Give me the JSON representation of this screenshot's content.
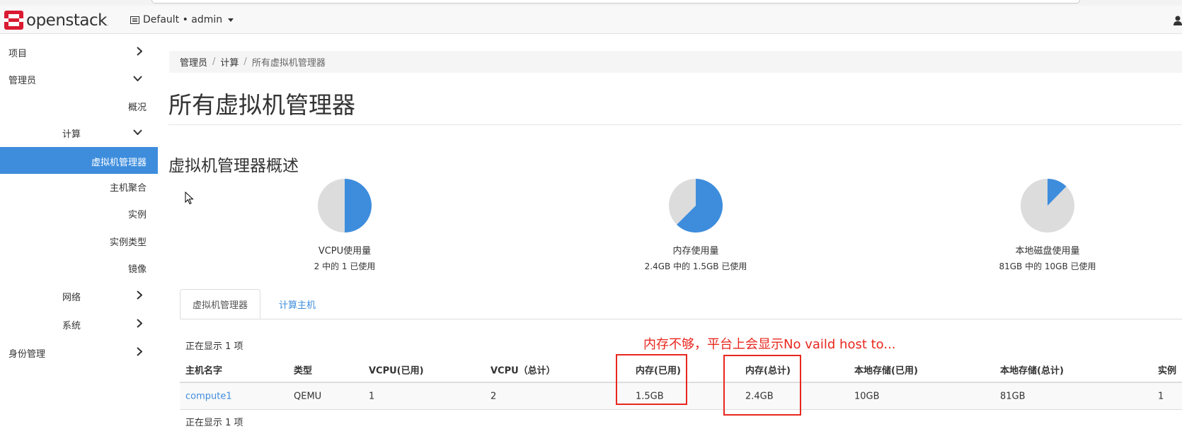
{
  "header": {
    "logo_text": "openstack",
    "project_switch": "Default • admin",
    "icons": [
      "openstack-logo",
      "project-list-icon",
      "user-icon"
    ]
  },
  "sidebar": {
    "items": [
      {
        "label": "项目",
        "icon": "chevron-right-icon"
      },
      {
        "label": "管理员",
        "icon": "chevron-down-icon"
      },
      {
        "label": "概况"
      },
      {
        "label": "计算",
        "icon": "chevron-down-icon"
      },
      {
        "label": "虚拟机管理器",
        "active": true
      },
      {
        "label": "主机聚合"
      },
      {
        "label": "实例"
      },
      {
        "label": "实例类型"
      },
      {
        "label": "镜像"
      },
      {
        "label": "网络",
        "icon": "chevron-right-icon"
      },
      {
        "label": "系统",
        "icon": "chevron-right-icon"
      },
      {
        "label": "身份管理",
        "icon": "chevron-right-icon"
      }
    ],
    "active_color": "#3e8ddd"
  },
  "breadcrumb": {
    "items": [
      "管理员",
      "计算",
      "所有虚拟机管理器"
    ]
  },
  "page_title": "所有虚拟机管理器",
  "section_title": "虚拟机管理器概述",
  "usage": [
    {
      "label": "VCPU使用量",
      "detail": "2 中的 1 已使用",
      "fraction": 0.5
    },
    {
      "label": "内存使用量",
      "detail": "2.4GB 中的 1.5GB 已使用",
      "fraction": 0.625
    },
    {
      "label": "本地磁盘使用量",
      "detail": "81GB 中的 10GB 已使用",
      "fraction": 0.123
    }
  ],
  "tabs": [
    {
      "label": "虚拟机管理器",
      "active": true
    },
    {
      "label": "计算主机",
      "active": false
    }
  ],
  "count_top": "正在显示 1 项",
  "count_bottom": "正在显示 1 项",
  "annotation": "内存不够，平台上会显示No vaild host to...",
  "table": {
    "headers": [
      "主机名字",
      "类型",
      "VCPU(已用)",
      "VCPU（总计）",
      "内存(已用)",
      "内存(总计)",
      "本地存储(已用)",
      "本地存储(总计)",
      "实例"
    ],
    "rows": [
      [
        "compute1",
        "QEMU",
        "1",
        "2",
        "1.5GB",
        "2.4GB",
        "10GB",
        "81GB",
        "1"
      ]
    ]
  },
  "colors": {
    "accent": "#3e8ddd",
    "pie_empty": "#dcdcdc",
    "annotation": "#e8271e"
  }
}
